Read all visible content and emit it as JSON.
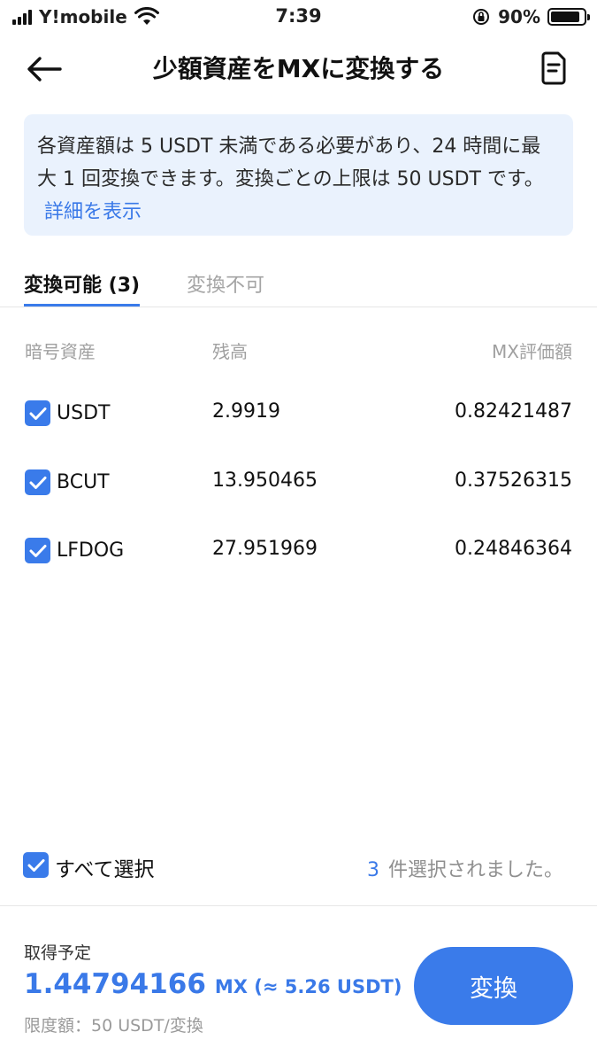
{
  "status_bar": {
    "carrier": "Y!mobile",
    "time": "7:39",
    "battery": "90%",
    "battery_level": 0.9
  },
  "header": {
    "title": "少額資産をMXに変換する"
  },
  "notice": {
    "text": "各資産額は 5 USDT 未満である必要があり、24 時間に最大 1 回変換できます。変換ごとの上限は 50 USDT です。",
    "link": "詳細を表示"
  },
  "tabs": [
    {
      "label": "変換可能 (3)",
      "active": true
    },
    {
      "label": "変換不可",
      "active": false
    }
  ],
  "table": {
    "columns": [
      "暗号資産",
      "残高",
      "MX評価額"
    ],
    "rows": [
      {
        "asset": "USDT",
        "balance": "2.9919",
        "mx_value": "0.82421487",
        "checked": true
      },
      {
        "asset": "BCUT",
        "balance": "13.950465",
        "mx_value": "0.37526315",
        "checked": true
      },
      {
        "asset": "LFDOG",
        "balance": "27.951969",
        "mx_value": "0.24846364",
        "checked": true
      }
    ]
  },
  "select_all": {
    "label": "すべて選択",
    "checked": true,
    "count": "3",
    "count_suffix": "件選択されました。"
  },
  "footer": {
    "receive_label": "取得予定",
    "amount": "1.44794166",
    "amount_unit": "MX (≈ 5.26 USDT)",
    "limit": "限度額：50 USDT/変換",
    "convert_label": "変換"
  },
  "colors": {
    "accent": "#3a7bea",
    "notice_bg": "#eaf2fd",
    "muted_text": "#a0a0a0"
  }
}
